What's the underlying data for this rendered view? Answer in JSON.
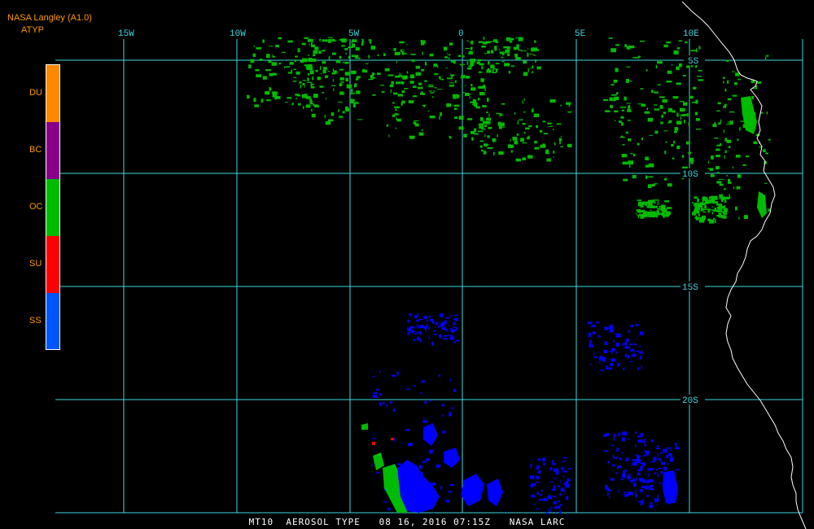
{
  "header": {
    "source": "NASA Langley (A1.0)",
    "product": "ATYP"
  },
  "legend": {
    "items": [
      {
        "label": "DU",
        "color": "#ff8800"
      },
      {
        "label": "BC",
        "color": "#880088"
      },
      {
        "label": "OC",
        "color": "#00bb00"
      },
      {
        "label": "SU",
        "color": "#ff0000"
      },
      {
        "label": "SS",
        "color": "#0055ff"
      }
    ]
  },
  "grid": {
    "color": "#40d8e0",
    "lon_labels": [
      "15W",
      "10W",
      "5W",
      "0",
      "5E",
      "10E"
    ],
    "lat_labels": [
      "5S",
      "10S",
      "15S",
      "20S"
    ]
  },
  "footer": {
    "text": "MT10  AEROSOL TYPE   08 16, 2016 07:15Z   NASA LARC"
  },
  "colors": {
    "background": "#000000",
    "coastline": "#ffffff",
    "oc": "#00bb00",
    "ss": "#0000ff",
    "su": "#ff0000"
  }
}
